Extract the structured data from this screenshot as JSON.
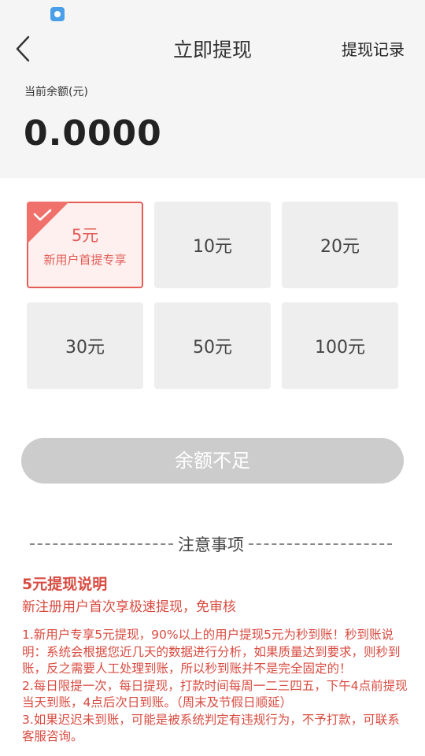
{
  "header": {
    "title": "立即提现",
    "history_link": "提现记录"
  },
  "balance": {
    "label": "当前余额(元)",
    "value": "0.0000"
  },
  "amounts": [
    {
      "label": "5元",
      "sub": "新用户首提专享",
      "selected": true
    },
    {
      "label": "10元"
    },
    {
      "label": "20元"
    },
    {
      "label": "30元"
    },
    {
      "label": "50元"
    },
    {
      "label": "100元"
    }
  ],
  "submit_button": "余额不足",
  "notice": {
    "heading": "注意事项",
    "section_title": "5元提现说明",
    "section_subtitle": "新注册用户首次享极速提现，免审核",
    "rules": [
      "1.新用户专享5元提现，90%以上的用户提现5元为秒到账！秒到账说明：系统会根据您近几天的数据进行分析，如果质量达到要求，则秒到账，反之需要人工处理到账，所以秒到账并不是完全固定的！",
      "2.每日限提一次，每日提现，打款时间每周一二三四五，下午4点前提现当天到账，4点后次日到账。（周末及节假日顺延）",
      "3.如果迟迟未到账，可能是被系统判定有违规行为，不予打款，可联系客服咨询。"
    ]
  },
  "colors": {
    "accent": "#e35d56",
    "disabled": "#cccccc",
    "header_bg": "#f5f5f5"
  }
}
